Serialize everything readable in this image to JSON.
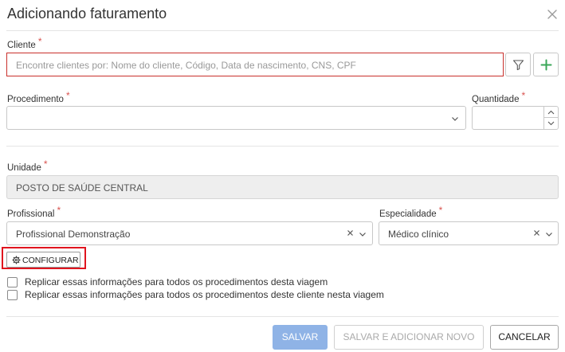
{
  "modal": {
    "title": "Adicionando faturamento"
  },
  "cliente": {
    "label": "Cliente",
    "required_mark": "*",
    "placeholder": "Encontre clientes por: Nome do cliente, Código, Data de nascimento, CNS, CPF",
    "value": ""
  },
  "procedimento": {
    "label": "Procedimento",
    "required_mark": "*",
    "value": ""
  },
  "quantidade": {
    "label": "Quantidade",
    "required_mark": "*",
    "value": ""
  },
  "unidade": {
    "label": "Unidade",
    "required_mark": "*",
    "value": "POSTO DE SAÚDE CENTRAL"
  },
  "profissional": {
    "label": "Profissional",
    "required_mark": "*",
    "value": "Profissional Demonstração"
  },
  "especialidade": {
    "label": "Especialidade",
    "required_mark": "*",
    "value": "Médico clínico"
  },
  "configurar": {
    "label": "CONFIGURAR"
  },
  "options": [
    {
      "label": "Replicar essas informações para todos os procedimentos desta viagem",
      "checked": false
    },
    {
      "label": "Replicar essas informações para todos os procedimentos deste cliente nesta viagem",
      "checked": false
    }
  ],
  "footer": {
    "save_label": "SALVAR",
    "save_add_label": "SALVAR E ADICIONAR NOVO",
    "cancel_label": "CANCELAR"
  },
  "colors": {
    "primary": "#8fb3e6",
    "error": "#c9302c",
    "required": "#d9534f",
    "add_icon": "#3aa757",
    "highlight": "#e0141e"
  }
}
